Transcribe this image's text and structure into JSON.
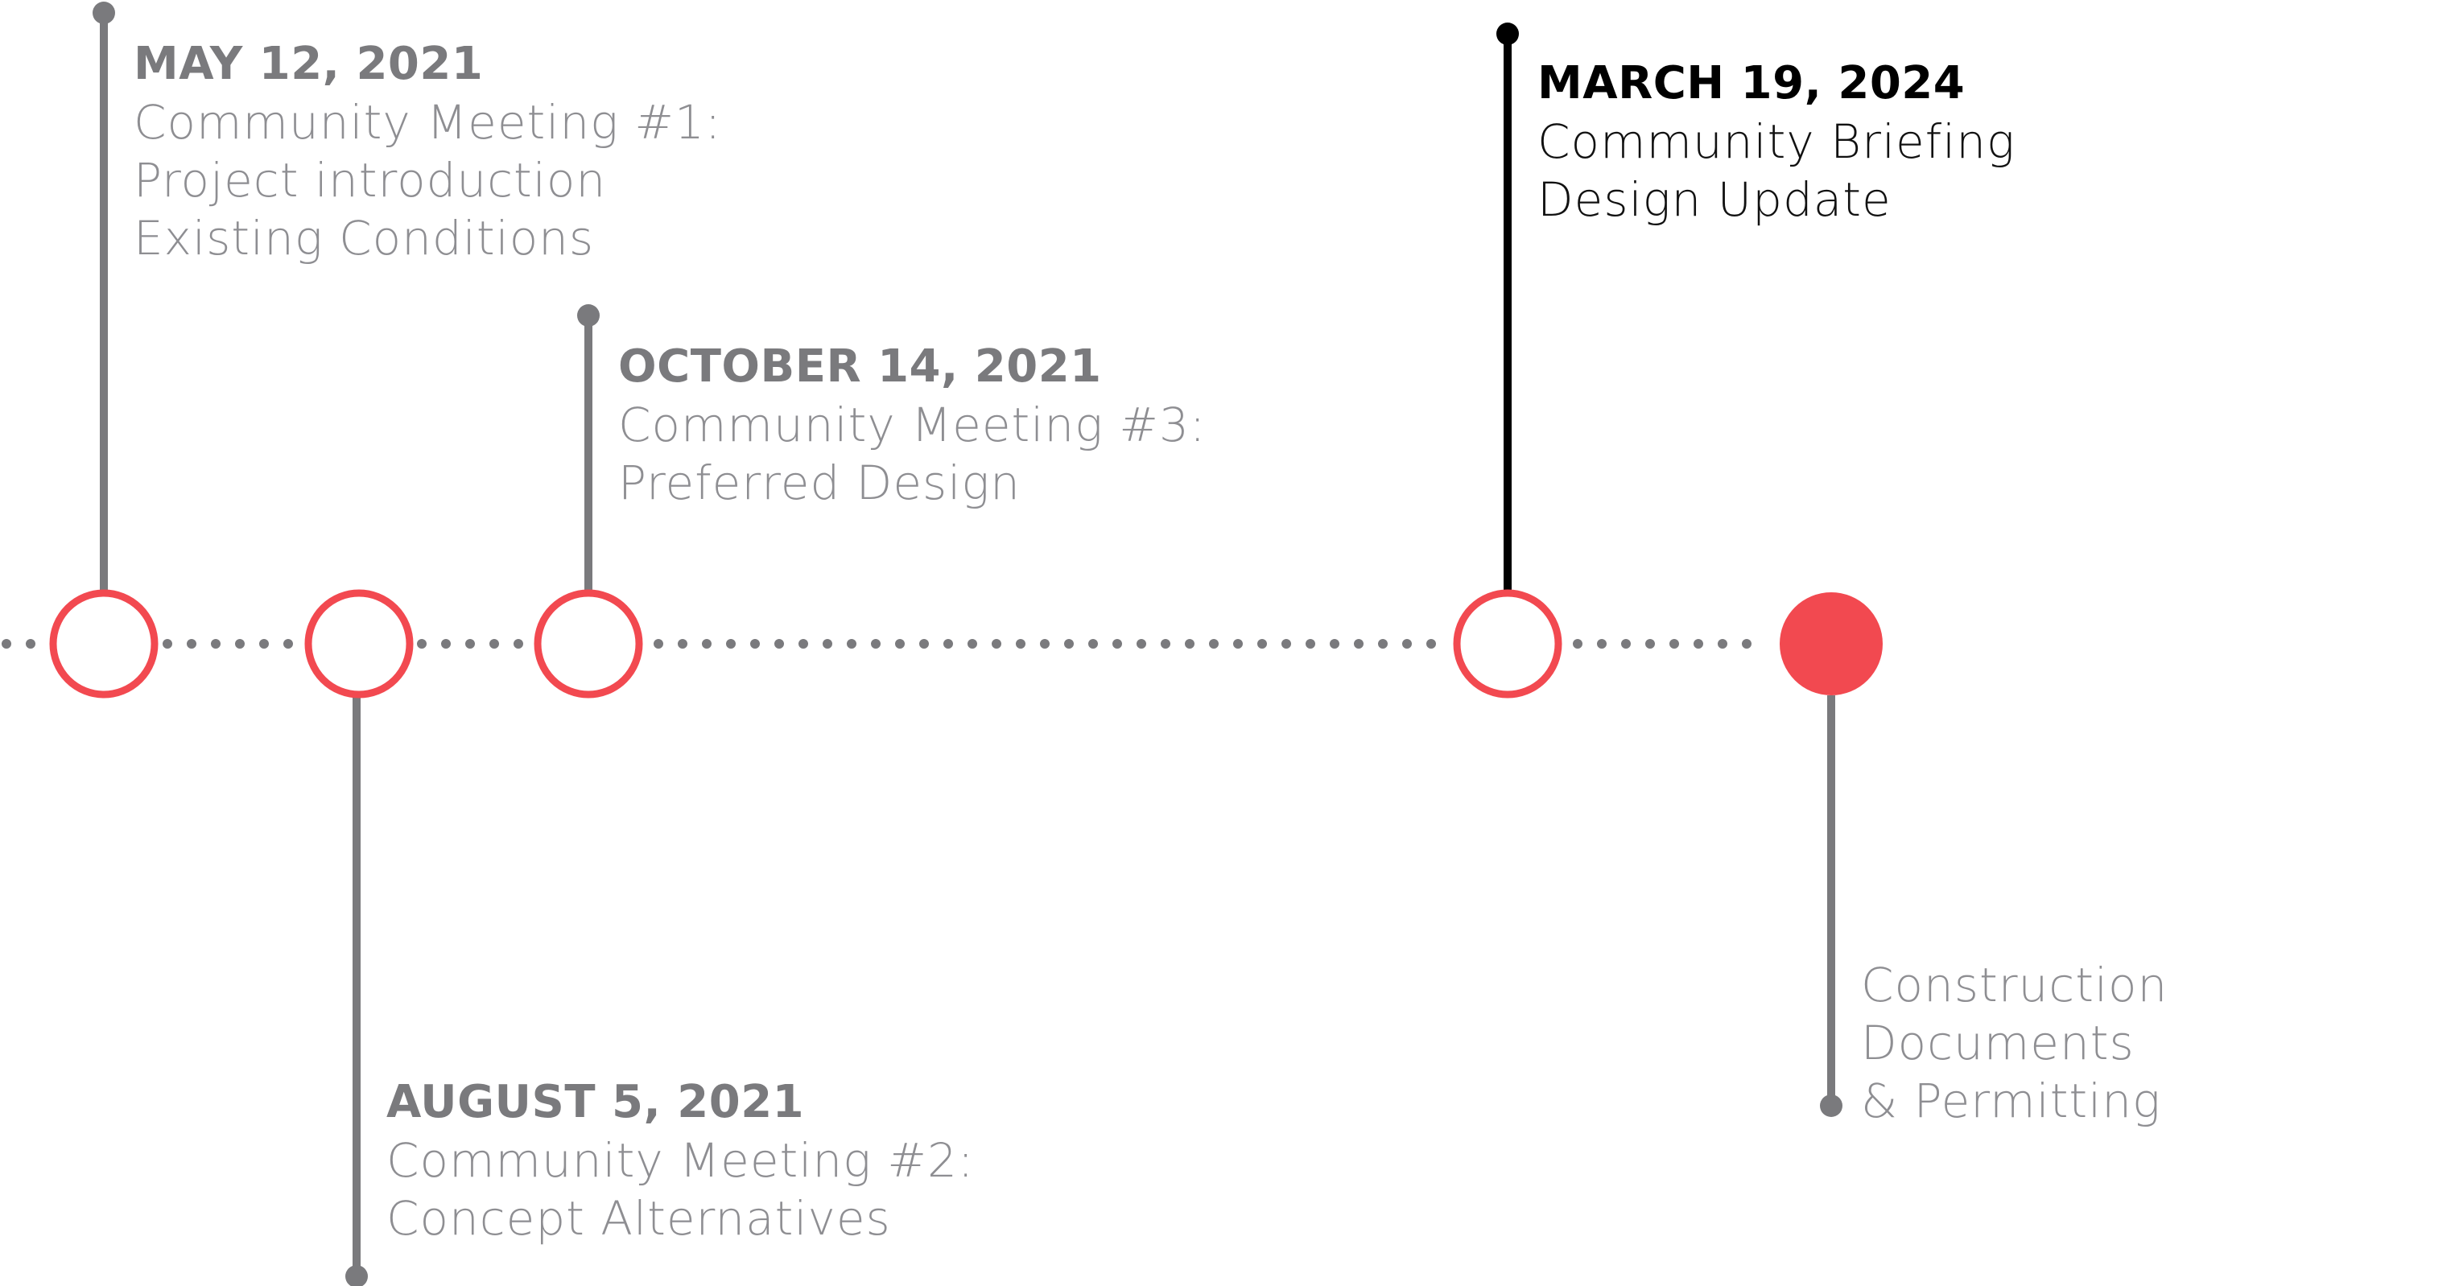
{
  "colors": {
    "muted_stem": "#7a7a7d",
    "active_stem": "#000000",
    "node_ring": "#f24950",
    "node_fill_current": "#f24950",
    "dotted_axis": "#7a7a7d",
    "muted_text": "#8e8e92",
    "active_text": "#111111"
  },
  "milestones": [
    {
      "date": "MAY 12, 2021",
      "lines": [
        "Community Meeting #1:",
        "Project introduction",
        "Existing Conditions"
      ],
      "state": "past"
    },
    {
      "date": "AUGUST 5, 2021",
      "lines": [
        "Community Meeting #2:",
        "Concept Alternatives"
      ],
      "state": "past"
    },
    {
      "date": "OCTOBER 14, 2021",
      "lines": [
        "Community Meeting #3:",
        "Preferred Design"
      ],
      "state": "past"
    },
    {
      "date": "MARCH 19, 2024",
      "lines": [
        "Community Briefing",
        "Design Update"
      ],
      "state": "current"
    },
    {
      "date": "",
      "lines": [
        "Construction Documents",
        "& Permitting"
      ],
      "state": "upcoming"
    }
  ]
}
